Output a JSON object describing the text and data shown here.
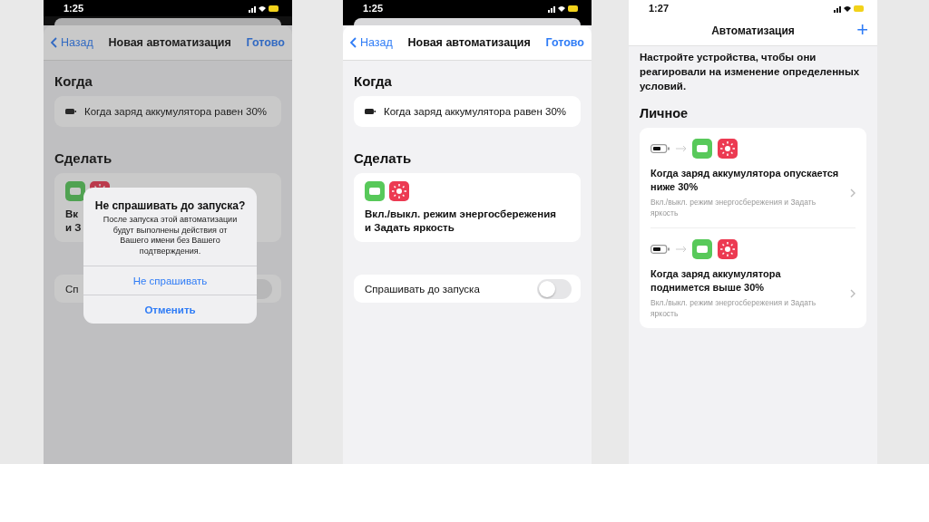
{
  "screens": [
    {
      "kind": "editor",
      "time": "1:25",
      "dimmed": true,
      "nav": {
        "back": "Назад",
        "title": "Новая автоматизация",
        "done": "Готово"
      },
      "when_header": "Когда",
      "trigger": "Когда заряд аккумулятора равен 30%",
      "do_header": "Сделать",
      "action_lines": [
        "Вк",
        "и З"
      ],
      "ask_label": "Сп",
      "ask_on": false,
      "alert": {
        "title": "Не спрашивать до запуска?",
        "message": "После запуска этой автоматизации будут выполнены действия от Вашего имени без Вашего подтверждения.",
        "buttons": [
          {
            "label": "Не спрашивать",
            "bold": false
          },
          {
            "label": "Отменить",
            "bold": true
          }
        ]
      }
    },
    {
      "kind": "editor",
      "time": "1:25",
      "dimmed": false,
      "nav": {
        "back": "Назад",
        "title": "Новая автоматизация",
        "done": "Готово"
      },
      "when_header": "Когда",
      "trigger": "Когда заряд аккумулятора равен 30%",
      "do_header": "Сделать",
      "action_lines": [
        "Вкл./выкл. режим энергосбережения",
        "и Задать яркость"
      ],
      "ask_label": "Спрашивать до запуска",
      "ask_on": false
    },
    {
      "kind": "list",
      "time": "1:27",
      "title": "Автоматизация",
      "add": "+",
      "intro": "Настройте устройства, чтобы они реагировали на изменение определенных условий.",
      "section": "Личное",
      "items": [
        {
          "title": "Когда заряд аккумулятора опускается ниже 30%",
          "subtitle": "Вкл./выкл. режим энергосбережения и Задать яркость"
        },
        {
          "title": "Когда заряд аккумулятора поднимется выше 30%",
          "subtitle": "Вкл./выкл. режим энергосбережения и Задать яркость"
        }
      ]
    }
  ]
}
